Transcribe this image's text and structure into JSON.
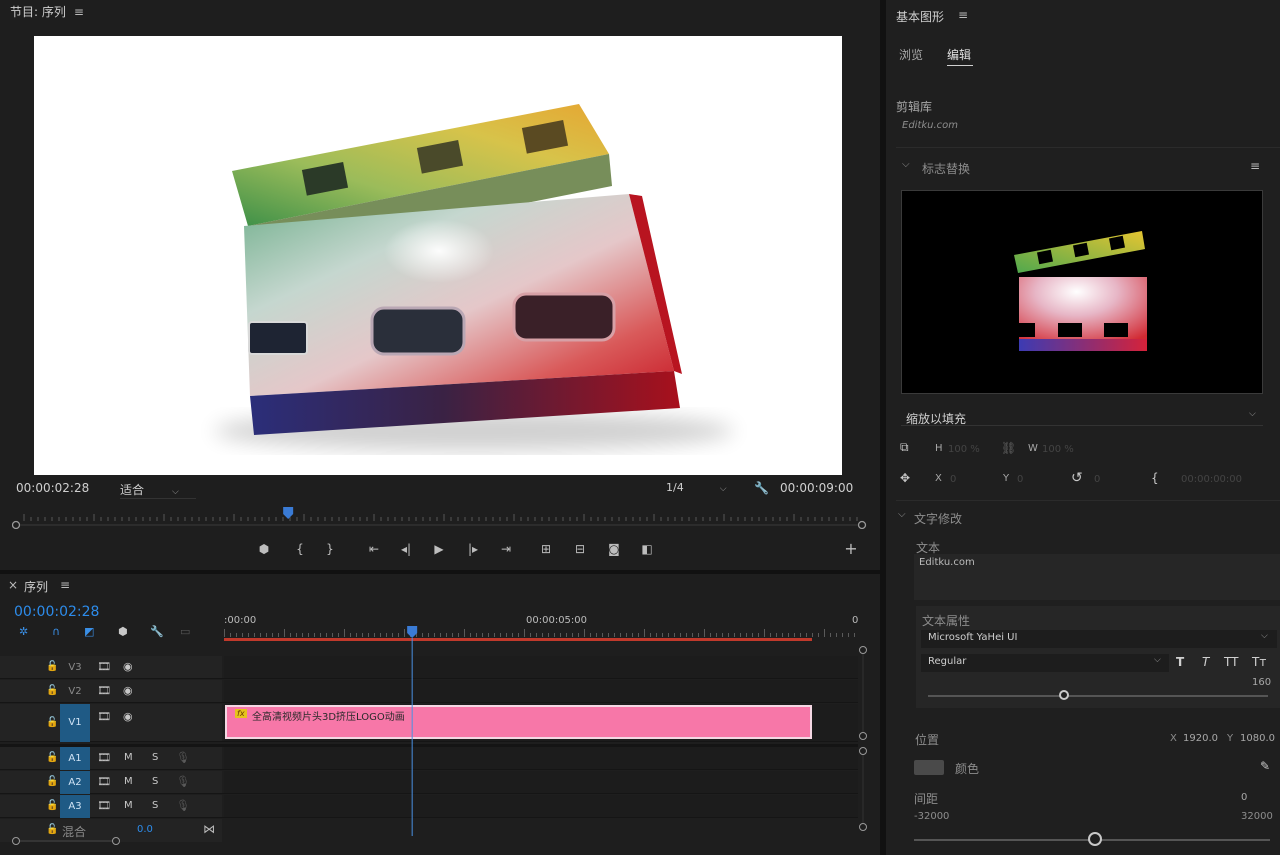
{
  "program": {
    "title": "节目: 序列",
    "timecode_current": "00:00:02:28",
    "fit": "适合",
    "resolution": "1/4",
    "timecode_duration": "00:00:09:00",
    "playhead_fraction": 0.32
  },
  "timeline": {
    "tab_close": "×",
    "title": "序列",
    "timecode": "00:00:02:28",
    "ruler_labels": [
      ":00:00",
      "00:00:05:00",
      "0"
    ],
    "tracks": [
      {
        "name": "V3",
        "type": "video",
        "active": false
      },
      {
        "name": "V2",
        "type": "video",
        "active": false
      },
      {
        "name": "V1",
        "type": "video",
        "active": true
      },
      {
        "name": "A1",
        "type": "audio",
        "active": true
      },
      {
        "name": "A2",
        "type": "audio",
        "active": true
      },
      {
        "name": "A3",
        "type": "audio",
        "active": true
      }
    ],
    "mix_label": "混合",
    "mix_value": "0.0",
    "audio_m": "M",
    "audio_s": "S",
    "clip_badge": "fx",
    "clip_name": "全高清视频片头3D挤压LOGO动画"
  },
  "graphics": {
    "panel_title": "基本图形",
    "tabs": [
      "浏览",
      "编辑"
    ],
    "active_tab": "编辑",
    "library_label": "剪辑库",
    "library_value": "Editku.com",
    "logo_section": "标志替换",
    "scale_mode": "缩放以填充",
    "h_label": "H",
    "h_value": "100 %",
    "w_label": "W",
    "w_value": "100 %",
    "x_label": "X",
    "x_value": "0",
    "y_label": "Y",
    "y_value": "0",
    "rot_value": "0",
    "time_value": "00:00:00:00",
    "text_section": "文字修改",
    "text_label": "文本",
    "text_value": "Editku.com",
    "text_props_label": "文本属性",
    "font": "Microsoft YaHei UI",
    "font_style": "Regular",
    "font_size": "160",
    "position_label": "位置",
    "pos_x_label": "X",
    "pos_x": "1920.0",
    "pos_y_label": "Y",
    "pos_y": "1080.0",
    "color_label": "颜色",
    "spacing_label": "间距",
    "spacing_value": "0",
    "spacing_min": "-32000",
    "spacing_max": "32000",
    "type_buttons": [
      "T",
      "T",
      "TT",
      "Tт"
    ]
  },
  "colors": {
    "accent": "#2d8ceb",
    "clip": "#f777a8",
    "playhead": "#4a90e2",
    "workarea": "#c0392b"
  }
}
